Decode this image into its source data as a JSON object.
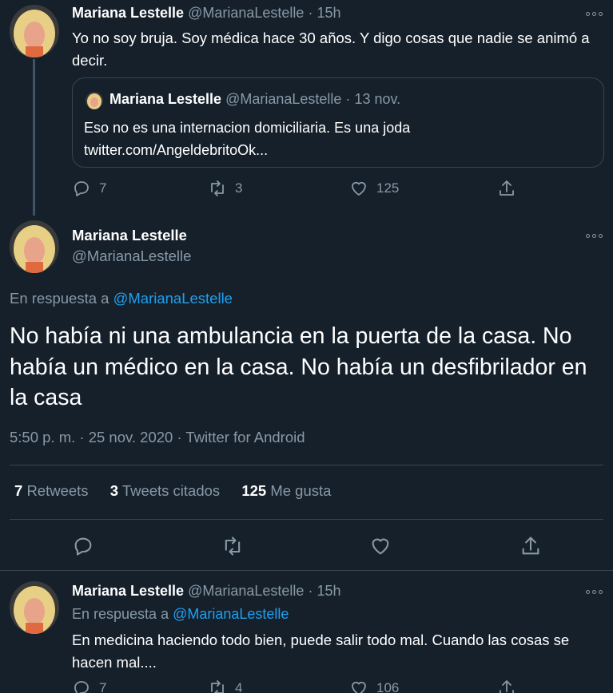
{
  "tweet1": {
    "name": "Mariana Lestelle",
    "handle": "@MarianaLestelle",
    "time": "15h",
    "text": "Yo no soy bruja. Soy médica hace 30 años. Y digo cosas que nadie se animó a decir.",
    "quote": {
      "name": "Mariana Lestelle",
      "handle": "@MarianaLestelle",
      "date": "13 nov.",
      "text_line1": "Eso no es una internacion domiciliaria. Es una joda",
      "text_line2": "twitter.com/AngeldebritoOk..."
    },
    "replies": "7",
    "retweets": "3",
    "likes": "125"
  },
  "tweet2": {
    "name": "Mariana Lestelle",
    "handle": "@MarianaLestelle",
    "reply_prefix": "En respuesta a",
    "reply_to": "@MarianaLestelle",
    "text": "No había ni una ambulancia en la puerta de la casa. No había un médico en la casa. No había un desfibrilador en la casa",
    "meta": "5:50 p. m. · 25 nov. 2020 · Twitter for Android",
    "stats": {
      "retweets_count": "7",
      "retweets_label": "Retweets",
      "quotes_count": "3",
      "quotes_label": "Tweets citados",
      "likes_count": "125",
      "likes_label": "Me gusta"
    }
  },
  "tweet3": {
    "name": "Mariana Lestelle",
    "handle": "@MarianaLestelle",
    "time": "15h",
    "reply_prefix": "En respuesta a",
    "reply_to": "@MarianaLestelle",
    "text": "En medicina haciendo todo bien, puede salir todo mal. Cuando las cosas se hacen mal....",
    "replies": "7",
    "retweets": "4",
    "likes": "106"
  },
  "colors": {
    "background": "#15202b",
    "muted": "#8899a6",
    "link": "#1da1f2",
    "border": "#38444d"
  },
  "icons": [
    "reply-icon",
    "retweet-icon",
    "like-icon",
    "share-icon",
    "more-icon"
  ]
}
